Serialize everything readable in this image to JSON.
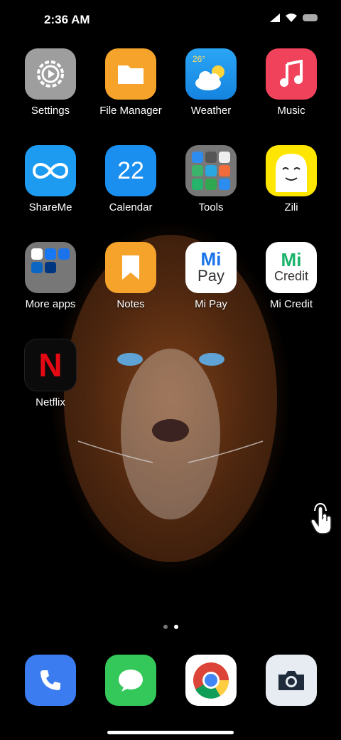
{
  "status": {
    "time": "2:36 AM"
  },
  "apps": {
    "settings": {
      "label": "Settings"
    },
    "file_manager": {
      "label": "File Manager"
    },
    "weather": {
      "label": "Weather",
      "temp": "26°"
    },
    "music": {
      "label": "Music"
    },
    "shareme": {
      "label": "ShareMe"
    },
    "calendar": {
      "label": "Calendar",
      "date": "22"
    },
    "tools": {
      "label": "Tools"
    },
    "zili": {
      "label": "Zili"
    },
    "more_apps": {
      "label": "More apps"
    },
    "notes": {
      "label": "Notes"
    },
    "mi_pay": {
      "label": "Mi Pay",
      "logo_top": "Mi",
      "logo_bottom": "Pay"
    },
    "mi_credit": {
      "label": "Mi Credit",
      "logo_top": "Mi",
      "logo_bottom": "Credit"
    },
    "netflix": {
      "label": "Netflix",
      "logo": "N"
    }
  },
  "pages": {
    "count": 2,
    "active": 2
  },
  "dock": [
    "Phone",
    "Messages",
    "Chrome",
    "Camera"
  ],
  "colors": {
    "settings": "#9e9e9e",
    "file_manager": "#f6a32c",
    "weather": "#1e9cf0",
    "music": "#f0435b",
    "shareme": "#1d9bf0",
    "calendar": "#1a8ff0",
    "notes": "#f6a32c",
    "phone": "#3b7df1",
    "messages": "#34c759",
    "camera": "#e6ecf2"
  }
}
